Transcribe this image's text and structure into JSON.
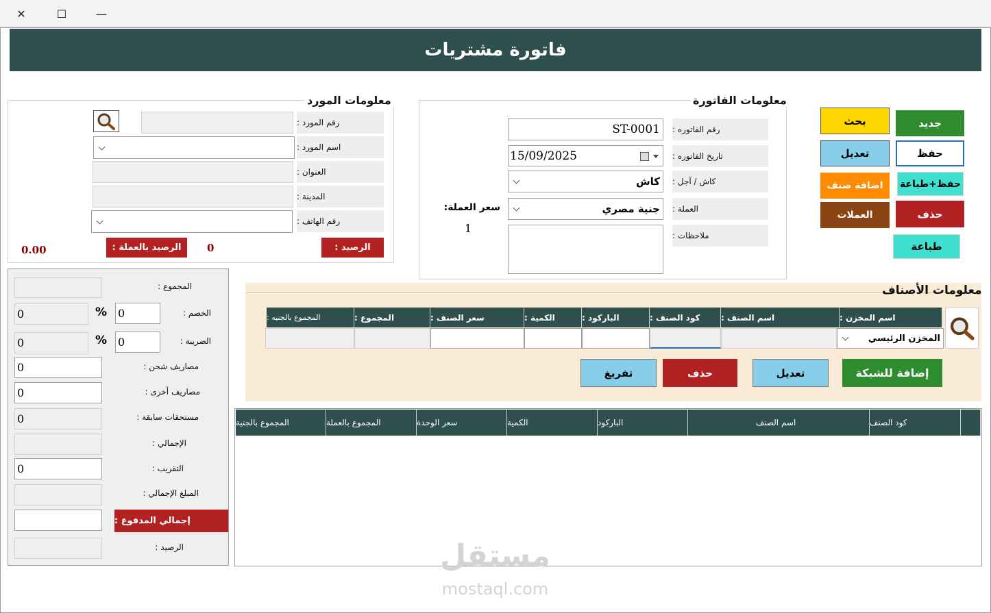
{
  "window": {
    "close": "✕",
    "maximize": "☐",
    "minimize": "—"
  },
  "header": {
    "title": "فاتورة مشتريات"
  },
  "actions": {
    "search": "بحث",
    "new": "جديد",
    "edit": "تعديل",
    "save": "حفظ",
    "add_item": "اضافة صنف",
    "save_print": "حفظ+طباعة",
    "currencies": "العملات",
    "delete": "حذف",
    "print": "طباعة"
  },
  "invoice": {
    "title": "معلومات الفاتورة",
    "number_label": "رقم الفاتوره :",
    "number": "ST-0001",
    "date_label": "تاريخ الفاتوره :",
    "date": "15/09/2025",
    "payment_label": "كاش / آجل :",
    "payment": "كاش",
    "currency_label": "العملة :",
    "currency": "جنية مصري",
    "notes_label": "ملاحظات :",
    "rate_label": "سعر العملة:",
    "rate": "1"
  },
  "supplier": {
    "title": "معلومات المورد",
    "number_label": "رقم المورد :",
    "name_label": "اسم المورد :",
    "address_label": "العنوان :",
    "city_label": "المدينة :",
    "phone_label": "رقم الهاتف :",
    "balance_label": "الرصيد :",
    "balance": "0",
    "balance_currency_label": "الرصيد بالعملة :",
    "balance_currency": "0.00"
  },
  "totals": {
    "sum_label": "المجموع :",
    "discount_label": "الخصم :",
    "discount_pct": "0",
    "discount_value": "0",
    "tax_label": "الضريبة :",
    "tax_pct": "0",
    "tax_value": "0",
    "percent": "%",
    "shipping_label": "مصاريف شحن :",
    "shipping": "0",
    "other_label": "مصاريف أخرى :",
    "other": "0",
    "previous_label": "مستحقات سابقة :",
    "previous": "0",
    "total_label": "الإجمالي :",
    "rounding_label": "التقريب :",
    "rounding": "0",
    "grand_label": "المبلغ الإجمالي :",
    "paid_label": "إجمالي المدفوع :",
    "balance_label": "الرصيد :"
  },
  "items": {
    "title": "معلومات الأصناف",
    "columns": [
      "اسم المخزن :",
      "اسم الصنف :",
      "كود الصنف :",
      "الباركود :",
      "الكمية :",
      "سعر الصنف :",
      "المجموع :",
      "المجموع بالجنيه :"
    ],
    "warehouse": "المخزن الرئيسي",
    "add_grid": "إضافة للشبكة",
    "edit": "تعديل",
    "delete": "حذف",
    "clear": "تفريغ"
  },
  "grid": {
    "columns": [
      "كود الصنف",
      "اسم الصنف",
      "الباركود",
      "الكمية",
      "سعر الوحدة",
      "المجموع بالعملة",
      "المجموع بالجنية"
    ]
  },
  "watermark": {
    "logo": "مستقل",
    "site": "mostaql.com"
  },
  "colors": {
    "header": "#2f4f4f",
    "yellow": "#ffd700",
    "green": "#2e8b2e",
    "skyblue": "#87ceeb",
    "orange": "#ff8c00",
    "turquoise": "#40e0d0",
    "brown": "#8b4513",
    "red": "#b22222",
    "beige": "#faebd7"
  }
}
